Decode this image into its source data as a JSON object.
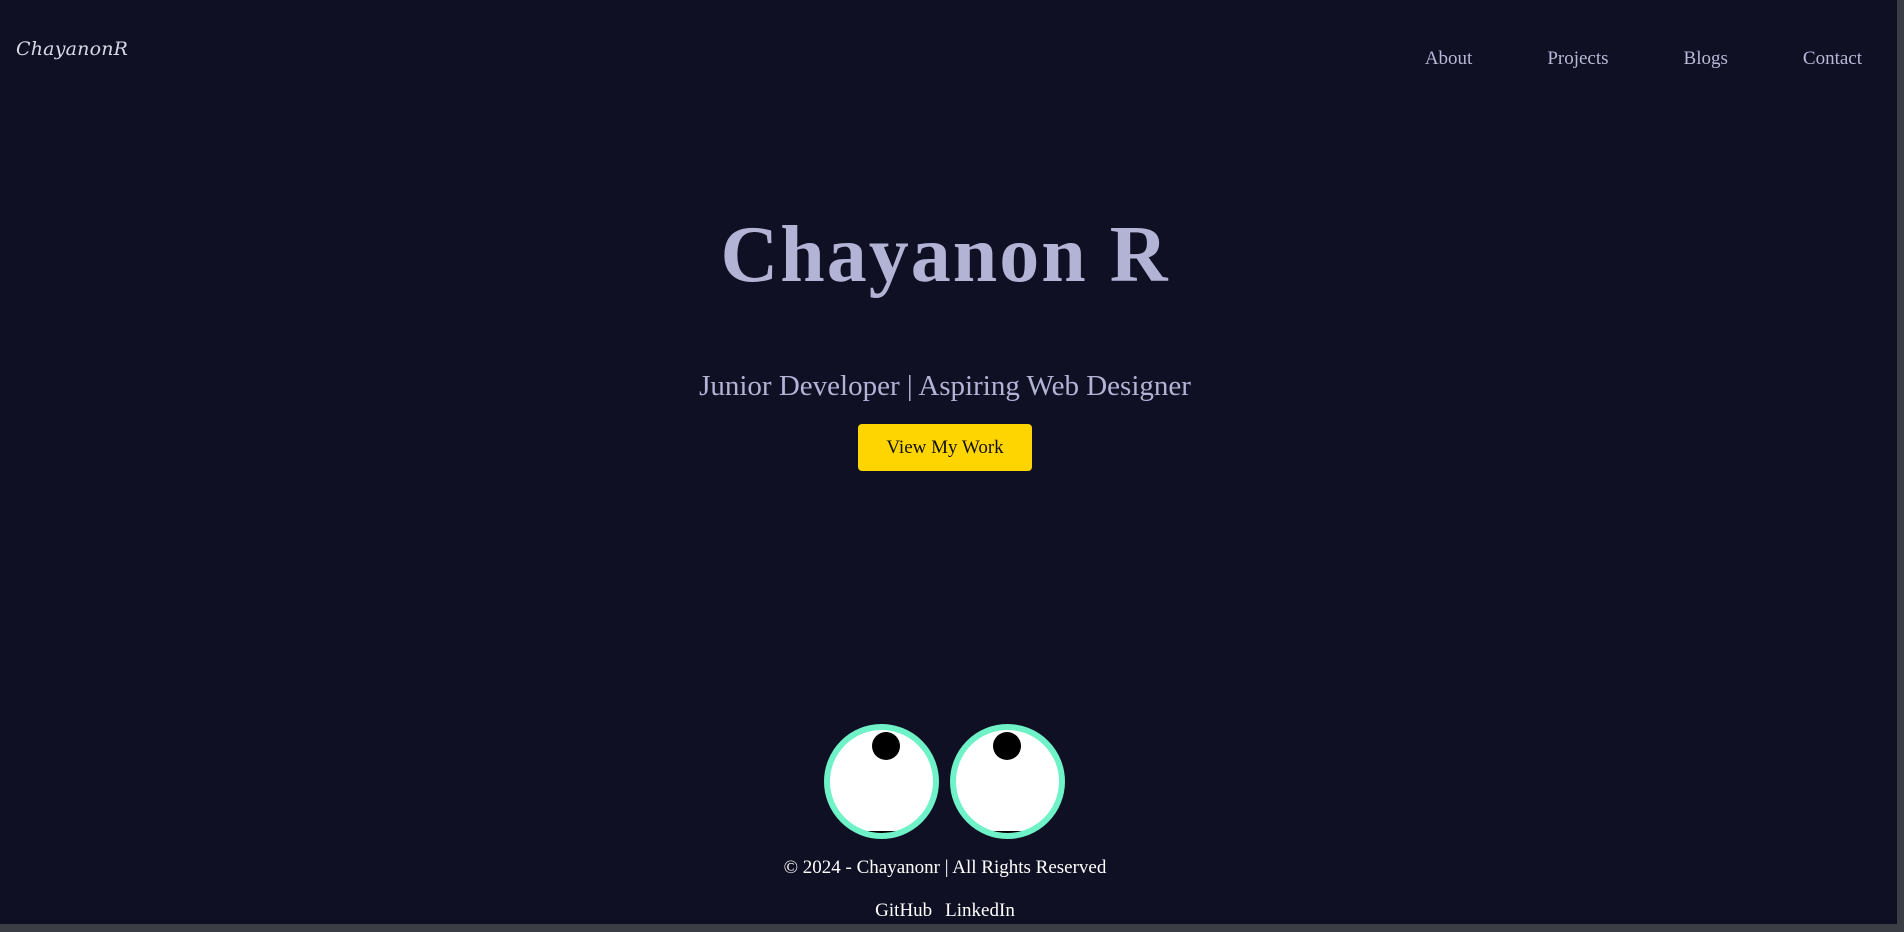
{
  "header": {
    "logo_text": "ChayanonR",
    "nav": [
      {
        "label": "About"
      },
      {
        "label": "Projects"
      },
      {
        "label": "Blogs"
      },
      {
        "label": "Contact"
      }
    ]
  },
  "hero": {
    "title": "Chayanon R",
    "subtitle": "Junior Developer | Aspiring Web Designer",
    "cta_label": "View My Work"
  },
  "footer": {
    "copyright": "© 2024 - Chayanonr | All Rights Reserved",
    "links": [
      {
        "label": "GitHub"
      },
      {
        "label": "LinkedIn"
      }
    ]
  },
  "colors": {
    "background": "#0f1023",
    "accent": "#ffd500",
    "eye_ring": "#6ff2c8",
    "text_muted": "#b3b3d6"
  },
  "icons": [
    "googly-eyes-icon"
  ]
}
